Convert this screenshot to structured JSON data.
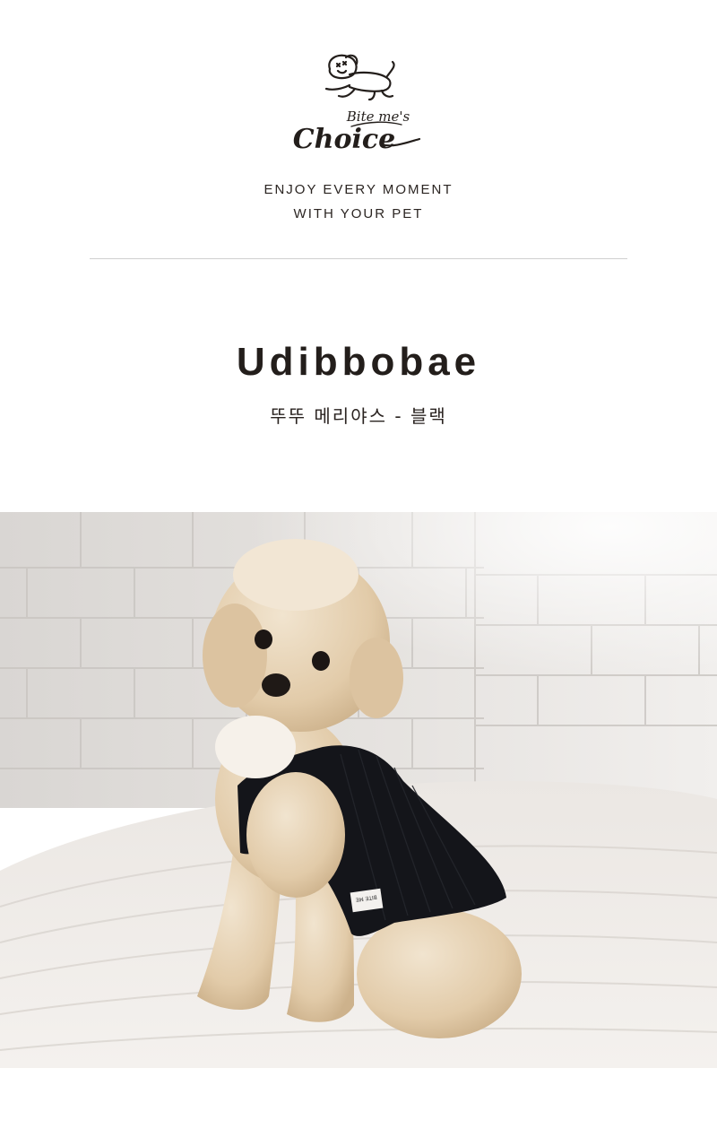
{
  "brand": {
    "logo_top_line": "Bite me's",
    "logo_main": "Choice",
    "logo_icon": "running-dog-icon"
  },
  "tagline": {
    "line1": "ENJOY EVERY MOMENT",
    "line2": "WITH YOUR PET"
  },
  "product": {
    "title": "Udibbobae",
    "subtitle": "뚜뚜 메리야스 - 블랙"
  },
  "photo": {
    "subject": "dog-in-black-top-photo",
    "label_text": "BITE ME"
  },
  "colors": {
    "text": "#231e1b",
    "divider": "#d0d0d0",
    "background": "#ffffff",
    "garment": "#14151a",
    "fur": "#e8d5b8"
  }
}
